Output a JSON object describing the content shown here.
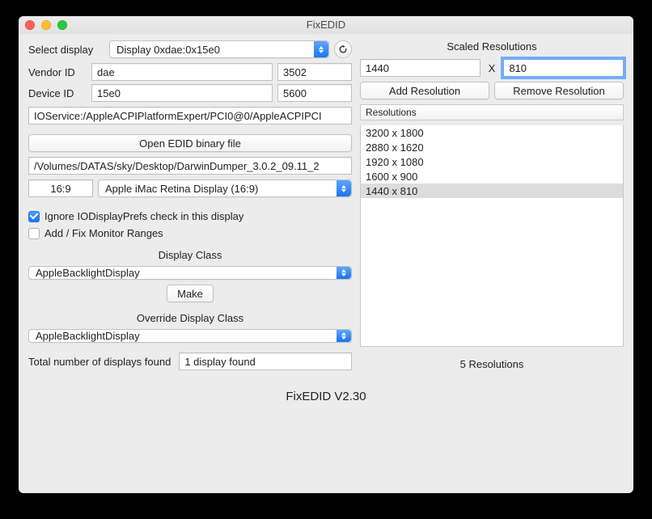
{
  "window": {
    "title": "FixEDID"
  },
  "selectDisplay": {
    "label": "Select display",
    "value": "Display 0xdae:0x15e0",
    "refreshIcon": "↻"
  },
  "vendor": {
    "label": "Vendor ID",
    "hex": "dae",
    "dec": "3502"
  },
  "device": {
    "label": "Device ID",
    "hex": "15e0",
    "dec": "5600"
  },
  "ioservice": "IOService:/AppleACPIPlatformExpert/PCI0@0/AppleACPIPCI",
  "openEdidBtn": "Open EDID binary file",
  "edidPath": "/Volumes/DATAS/sky/Desktop/DarwinDumper_3.0.2_09.11_2",
  "aspect": "16:9",
  "displayModel": "Apple iMac Retina Display (16:9)",
  "checkboxes": {
    "ignorePrefs": "Ignore IODisplayPrefs check in this display",
    "addFixRanges": "Add / Fix Monitor Ranges"
  },
  "displayClass": {
    "title": "Display Class",
    "value": "AppleBacklightDisplay"
  },
  "makeBtn": "Make",
  "overrideClass": {
    "title": "Override Display Class",
    "value": "AppleBacklightDisplay"
  },
  "totalDisplays": {
    "label": "Total number of displays found",
    "value": "1 display found"
  },
  "scaled": {
    "title": "Scaled Resolutions",
    "width": "1440",
    "height": "810",
    "xSep": "X",
    "addBtn": "Add Resolution",
    "removeBtn": "Remove Resolution",
    "header": "Resolutions",
    "items": [
      "3200 x 1800",
      "2880 x 1620",
      "1920 x 1080",
      "1600 x 900",
      "1440 x 810"
    ],
    "count": "5 Resolutions"
  },
  "footer": "FixEDID V2.30"
}
